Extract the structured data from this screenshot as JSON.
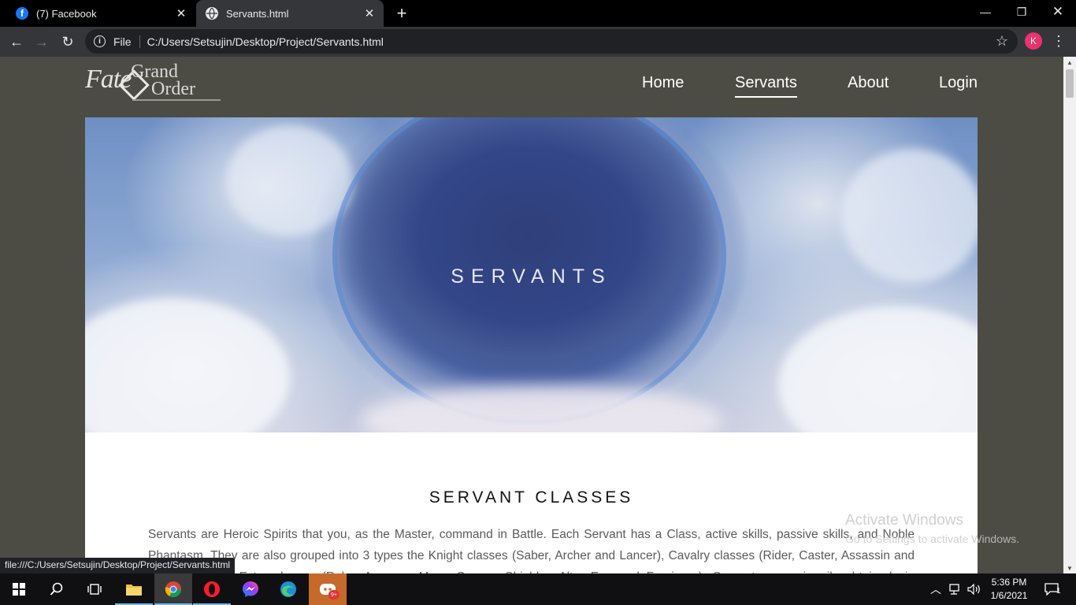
{
  "browser": {
    "tabs": [
      {
        "title": "(7) Facebook",
        "icon": "facebook-icon",
        "active": false
      },
      {
        "title": "Servants.html",
        "icon": "globe-icon",
        "active": true
      }
    ],
    "address_scheme": "File",
    "address_path": "C:/Users/Setsujin/Desktop/Project/Servants.html",
    "profile_initial": "K",
    "status_url": "file:///C:/Users/Setsujin/Desktop/Project/Servants.html"
  },
  "page": {
    "logo": {
      "word1": "Fate",
      "word2": "Grand",
      "word3": "Order"
    },
    "nav": [
      {
        "label": "Home",
        "active": false
      },
      {
        "label": "Servants",
        "active": true
      },
      {
        "label": "About",
        "active": false
      },
      {
        "label": "Login",
        "active": false
      }
    ],
    "hero_heading": "SERVANTS",
    "section_title": "SERVANT CLASSES",
    "section_text": "Servants are Heroic Spirits that you, as the Master, command in Battle. Each Servant has a Class, active skills, passive skills, and Noble Phantasm. They are also grouped into 3 types the Knight classes (Saber, Archer and Lancer), Cavalry classes (Rider, Caster, Assassin and Berserker) and Extra classes (Ruler, Avenger, Moon Cancer, Shielder, Alter Ego and Foreigner). Servants are primarily obtained via summoning."
  },
  "watermark": {
    "line1": "Activate Windows",
    "line2": "Go to Settings to activate Windows."
  },
  "taskbar": {
    "apps": [
      "start-icon",
      "search-icon",
      "task-view-icon",
      "file-explorer-icon",
      "chrome-icon",
      "opera-icon",
      "messenger-icon",
      "edge-icon",
      "discord-icon"
    ],
    "discord_badge": "9+",
    "time": "5:36 PM",
    "date": "1/6/2021",
    "notification_count": "1"
  },
  "colors": {
    "page_bg": "#4c4c44",
    "nav_text": "#ffffff",
    "chrome_dark": "#35363a"
  }
}
